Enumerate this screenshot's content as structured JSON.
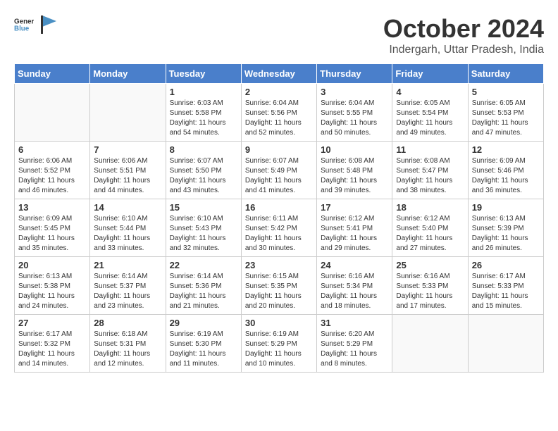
{
  "header": {
    "logo_line1": "General",
    "logo_line2": "Blue",
    "title": "October 2024",
    "subtitle": "Indergarh, Uttar Pradesh, India"
  },
  "columns": [
    "Sunday",
    "Monday",
    "Tuesday",
    "Wednesday",
    "Thursday",
    "Friday",
    "Saturday"
  ],
  "weeks": [
    [
      {
        "day": "",
        "sunrise": "",
        "sunset": "",
        "daylight": ""
      },
      {
        "day": "",
        "sunrise": "",
        "sunset": "",
        "daylight": ""
      },
      {
        "day": "1",
        "sunrise": "Sunrise: 6:03 AM",
        "sunset": "Sunset: 5:58 PM",
        "daylight": "Daylight: 11 hours and 54 minutes."
      },
      {
        "day": "2",
        "sunrise": "Sunrise: 6:04 AM",
        "sunset": "Sunset: 5:56 PM",
        "daylight": "Daylight: 11 hours and 52 minutes."
      },
      {
        "day": "3",
        "sunrise": "Sunrise: 6:04 AM",
        "sunset": "Sunset: 5:55 PM",
        "daylight": "Daylight: 11 hours and 50 minutes."
      },
      {
        "day": "4",
        "sunrise": "Sunrise: 6:05 AM",
        "sunset": "Sunset: 5:54 PM",
        "daylight": "Daylight: 11 hours and 49 minutes."
      },
      {
        "day": "5",
        "sunrise": "Sunrise: 6:05 AM",
        "sunset": "Sunset: 5:53 PM",
        "daylight": "Daylight: 11 hours and 47 minutes."
      }
    ],
    [
      {
        "day": "6",
        "sunrise": "Sunrise: 6:06 AM",
        "sunset": "Sunset: 5:52 PM",
        "daylight": "Daylight: 11 hours and 46 minutes."
      },
      {
        "day": "7",
        "sunrise": "Sunrise: 6:06 AM",
        "sunset": "Sunset: 5:51 PM",
        "daylight": "Daylight: 11 hours and 44 minutes."
      },
      {
        "day": "8",
        "sunrise": "Sunrise: 6:07 AM",
        "sunset": "Sunset: 5:50 PM",
        "daylight": "Daylight: 11 hours and 43 minutes."
      },
      {
        "day": "9",
        "sunrise": "Sunrise: 6:07 AM",
        "sunset": "Sunset: 5:49 PM",
        "daylight": "Daylight: 11 hours and 41 minutes."
      },
      {
        "day": "10",
        "sunrise": "Sunrise: 6:08 AM",
        "sunset": "Sunset: 5:48 PM",
        "daylight": "Daylight: 11 hours and 39 minutes."
      },
      {
        "day": "11",
        "sunrise": "Sunrise: 6:08 AM",
        "sunset": "Sunset: 5:47 PM",
        "daylight": "Daylight: 11 hours and 38 minutes."
      },
      {
        "day": "12",
        "sunrise": "Sunrise: 6:09 AM",
        "sunset": "Sunset: 5:46 PM",
        "daylight": "Daylight: 11 hours and 36 minutes."
      }
    ],
    [
      {
        "day": "13",
        "sunrise": "Sunrise: 6:09 AM",
        "sunset": "Sunset: 5:45 PM",
        "daylight": "Daylight: 11 hours and 35 minutes."
      },
      {
        "day": "14",
        "sunrise": "Sunrise: 6:10 AM",
        "sunset": "Sunset: 5:44 PM",
        "daylight": "Daylight: 11 hours and 33 minutes."
      },
      {
        "day": "15",
        "sunrise": "Sunrise: 6:10 AM",
        "sunset": "Sunset: 5:43 PM",
        "daylight": "Daylight: 11 hours and 32 minutes."
      },
      {
        "day": "16",
        "sunrise": "Sunrise: 6:11 AM",
        "sunset": "Sunset: 5:42 PM",
        "daylight": "Daylight: 11 hours and 30 minutes."
      },
      {
        "day": "17",
        "sunrise": "Sunrise: 6:12 AM",
        "sunset": "Sunset: 5:41 PM",
        "daylight": "Daylight: 11 hours and 29 minutes."
      },
      {
        "day": "18",
        "sunrise": "Sunrise: 6:12 AM",
        "sunset": "Sunset: 5:40 PM",
        "daylight": "Daylight: 11 hours and 27 minutes."
      },
      {
        "day": "19",
        "sunrise": "Sunrise: 6:13 AM",
        "sunset": "Sunset: 5:39 PM",
        "daylight": "Daylight: 11 hours and 26 minutes."
      }
    ],
    [
      {
        "day": "20",
        "sunrise": "Sunrise: 6:13 AM",
        "sunset": "Sunset: 5:38 PM",
        "daylight": "Daylight: 11 hours and 24 minutes."
      },
      {
        "day": "21",
        "sunrise": "Sunrise: 6:14 AM",
        "sunset": "Sunset: 5:37 PM",
        "daylight": "Daylight: 11 hours and 23 minutes."
      },
      {
        "day": "22",
        "sunrise": "Sunrise: 6:14 AM",
        "sunset": "Sunset: 5:36 PM",
        "daylight": "Daylight: 11 hours and 21 minutes."
      },
      {
        "day": "23",
        "sunrise": "Sunrise: 6:15 AM",
        "sunset": "Sunset: 5:35 PM",
        "daylight": "Daylight: 11 hours and 20 minutes."
      },
      {
        "day": "24",
        "sunrise": "Sunrise: 6:16 AM",
        "sunset": "Sunset: 5:34 PM",
        "daylight": "Daylight: 11 hours and 18 minutes."
      },
      {
        "day": "25",
        "sunrise": "Sunrise: 6:16 AM",
        "sunset": "Sunset: 5:33 PM",
        "daylight": "Daylight: 11 hours and 17 minutes."
      },
      {
        "day": "26",
        "sunrise": "Sunrise: 6:17 AM",
        "sunset": "Sunset: 5:33 PM",
        "daylight": "Daylight: 11 hours and 15 minutes."
      }
    ],
    [
      {
        "day": "27",
        "sunrise": "Sunrise: 6:17 AM",
        "sunset": "Sunset: 5:32 PM",
        "daylight": "Daylight: 11 hours and 14 minutes."
      },
      {
        "day": "28",
        "sunrise": "Sunrise: 6:18 AM",
        "sunset": "Sunset: 5:31 PM",
        "daylight": "Daylight: 11 hours and 12 minutes."
      },
      {
        "day": "29",
        "sunrise": "Sunrise: 6:19 AM",
        "sunset": "Sunset: 5:30 PM",
        "daylight": "Daylight: 11 hours and 11 minutes."
      },
      {
        "day": "30",
        "sunrise": "Sunrise: 6:19 AM",
        "sunset": "Sunset: 5:29 PM",
        "daylight": "Daylight: 11 hours and 10 minutes."
      },
      {
        "day": "31",
        "sunrise": "Sunrise: 6:20 AM",
        "sunset": "Sunset: 5:29 PM",
        "daylight": "Daylight: 11 hours and 8 minutes."
      },
      {
        "day": "",
        "sunrise": "",
        "sunset": "",
        "daylight": ""
      },
      {
        "day": "",
        "sunrise": "",
        "sunset": "",
        "daylight": ""
      }
    ]
  ]
}
